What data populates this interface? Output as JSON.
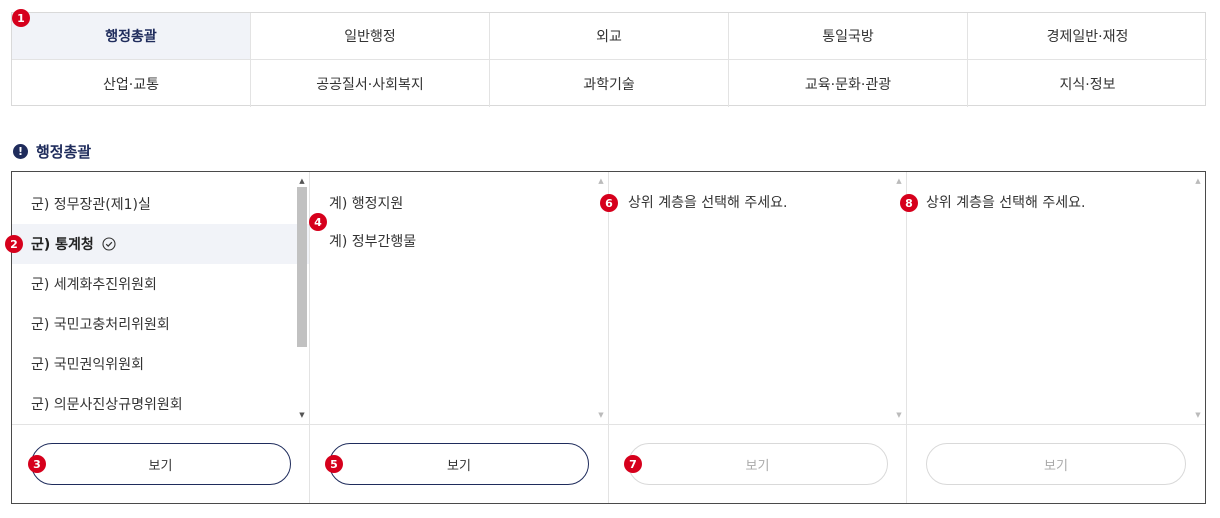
{
  "categories": [
    {
      "label": "행정총괄",
      "active": true
    },
    {
      "label": "일반행정"
    },
    {
      "label": "외교"
    },
    {
      "label": "통일국방"
    },
    {
      "label": "경제일반·재정"
    },
    {
      "label": "산업·교통"
    },
    {
      "label": "공공질서·사회복지"
    },
    {
      "label": "과학기술"
    },
    {
      "label": "교육·문화·관광"
    },
    {
      "label": "지식·정보"
    }
  ],
  "section_title": "행정총괄",
  "columns": {
    "col1": {
      "items": [
        {
          "label": "군) 정무장관(제1)실"
        },
        {
          "label": "군) 통계청",
          "selected": true
        },
        {
          "label": "군) 세계화추진위원회"
        },
        {
          "label": "군) 국민고충처리위원회"
        },
        {
          "label": "군) 국민권익위원회"
        },
        {
          "label": "군) 의문사진상규명위원회"
        }
      ],
      "button": "보기"
    },
    "col2": {
      "items": [
        {
          "label": "계) 행정지원"
        },
        {
          "label": "계) 정부간행물"
        }
      ],
      "button": "보기"
    },
    "col3": {
      "hint": "상위 계층을 선택해 주세요.",
      "button": "보기"
    },
    "col4": {
      "hint": "상위 계층을 선택해 주세요.",
      "button": "보기"
    }
  },
  "markers": [
    "1",
    "2",
    "3",
    "4",
    "5",
    "6",
    "7",
    "8"
  ],
  "icons": {
    "check": "check-circle-icon",
    "section": "exclamation-circle-icon",
    "scroll_up": "scroll-up-arrow-icon",
    "scroll_down": "scroll-down-arrow-icon"
  },
  "colors": {
    "accent": "#1f2c5c",
    "marker": "#d6001c",
    "active_bg": "#f1f3f8"
  }
}
